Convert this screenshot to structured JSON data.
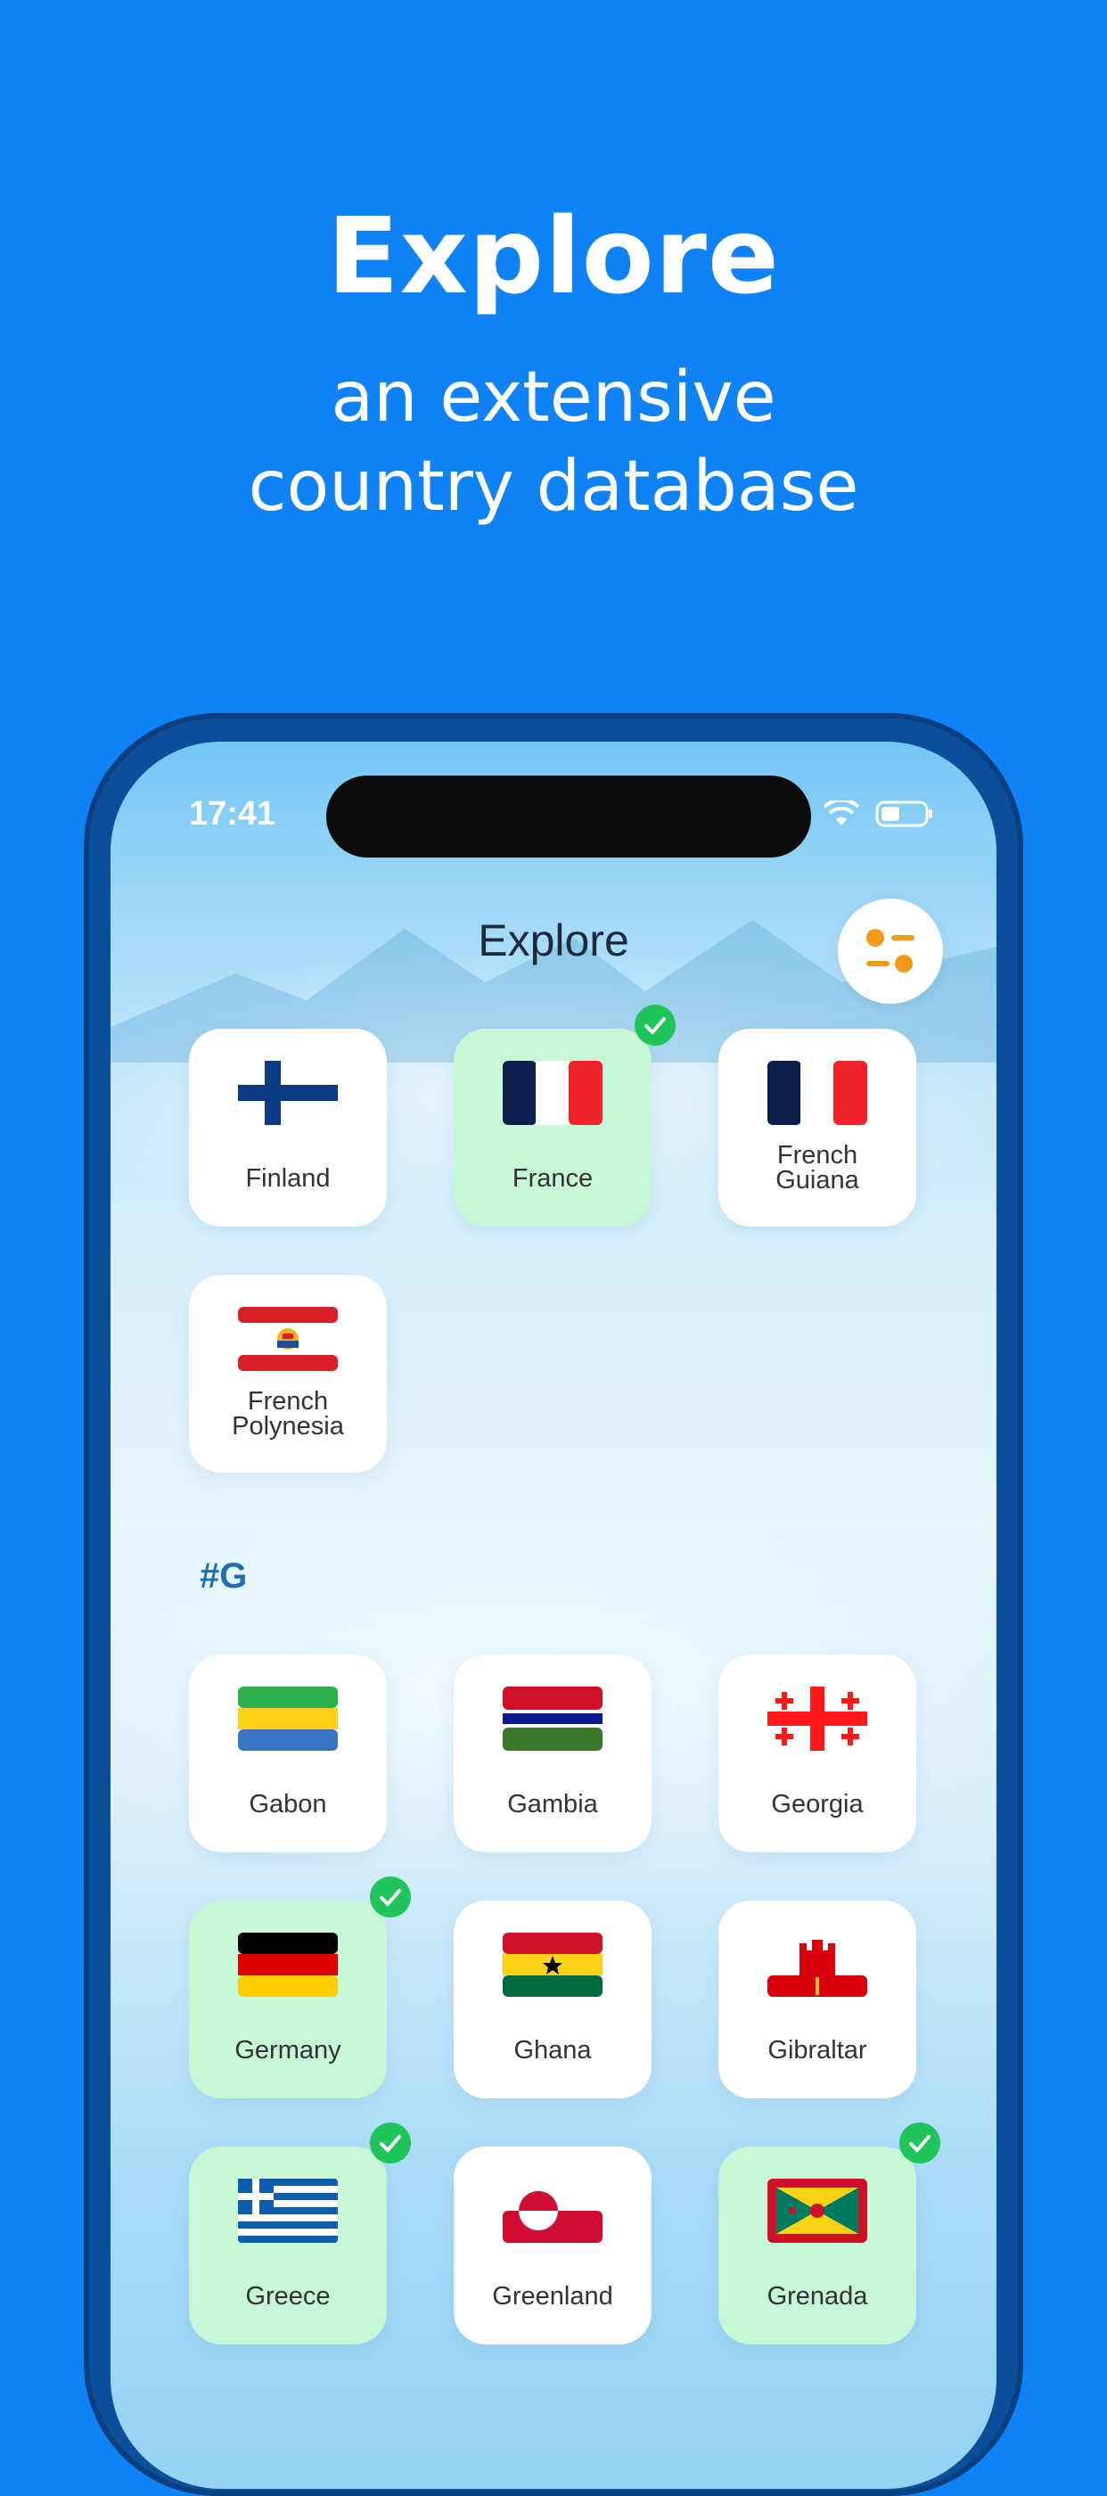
{
  "promo": {
    "title": "Explore",
    "subtitle_line1": "an extensive",
    "subtitle_line2": "country database"
  },
  "status_bar": {
    "time": "17:41"
  },
  "header": {
    "title": "Explore",
    "filter_icon": "filter-icon"
  },
  "sections": [
    {
      "tiles": [
        {
          "name": "Finland",
          "selected": false
        },
        {
          "name": "France",
          "selected": true
        },
        {
          "name_line1": "French",
          "name_line2": "Guiana",
          "selected": false
        },
        {
          "name_line1": "French",
          "name_line2": "Polynesia",
          "selected": false
        }
      ]
    },
    {
      "header": "#G",
      "tiles": [
        {
          "name": "Gabon",
          "selected": false
        },
        {
          "name": "Gambia",
          "selected": false
        },
        {
          "name": "Georgia",
          "selected": false
        },
        {
          "name": "Germany",
          "selected": true
        },
        {
          "name": "Ghana",
          "selected": false
        },
        {
          "name": "Gibraltar",
          "selected": false
        },
        {
          "name": "Greece",
          "selected": true
        },
        {
          "name": "Greenland",
          "selected": false
        },
        {
          "name": "Grenada",
          "selected": true
        }
      ]
    }
  ],
  "colors": {
    "background": "#0f82f6",
    "selected_tile": "#c6f7d6",
    "check": "#1fc45a",
    "accent": "#f39a1a"
  }
}
